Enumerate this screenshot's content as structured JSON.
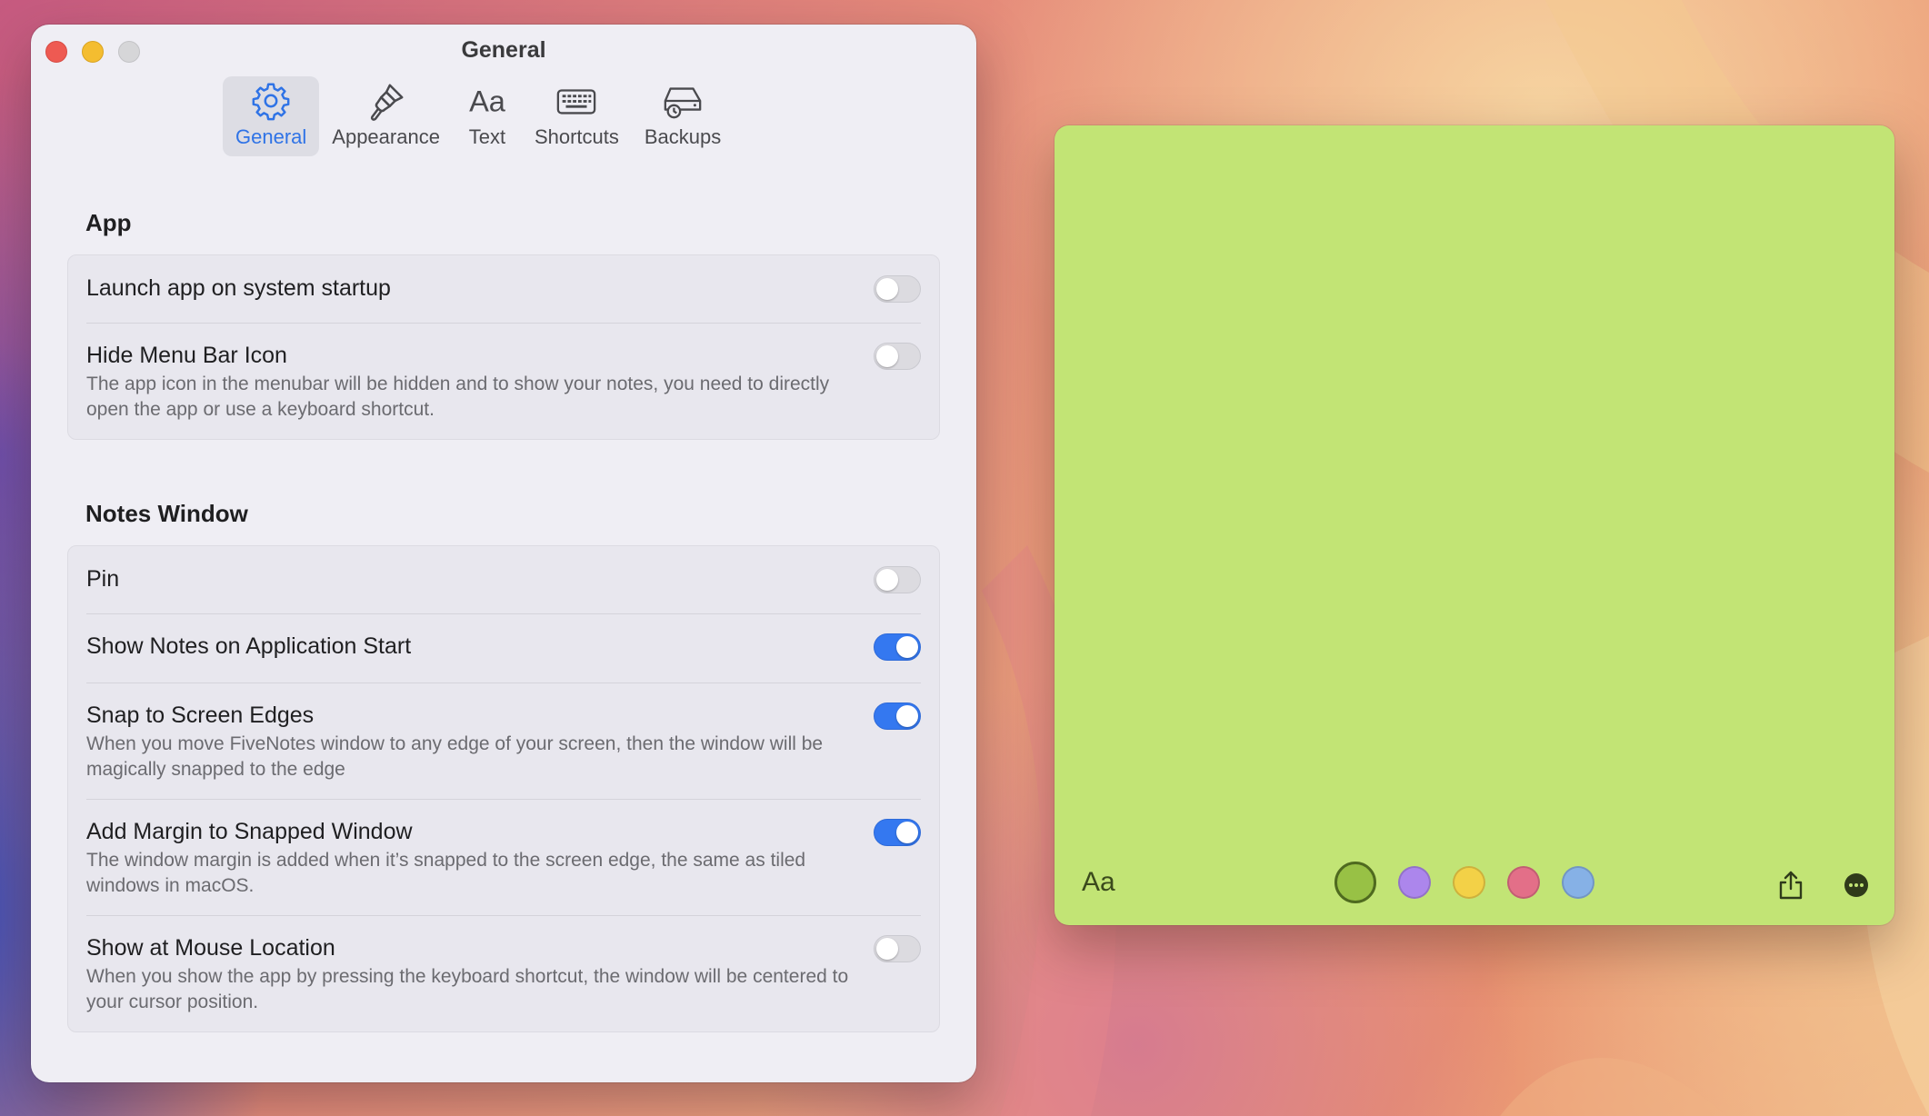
{
  "window": {
    "title": "General"
  },
  "tabs": [
    {
      "label": "General",
      "icon": "gear-icon",
      "active": true
    },
    {
      "label": "Appearance",
      "icon": "paintbrush-icon",
      "active": false
    },
    {
      "label": "Text",
      "icon": "text-format-icon",
      "active": false
    },
    {
      "label": "Shortcuts",
      "icon": "keyboard-icon",
      "active": false
    },
    {
      "label": "Backups",
      "icon": "backup-drive-icon",
      "active": false
    }
  ],
  "sections": {
    "app": {
      "title": "App",
      "rows": [
        {
          "label": "Launch app on system startup",
          "description": "",
          "enabled": false
        },
        {
          "label": "Hide Menu Bar Icon",
          "description": "The app icon in the menubar will be hidden and to show your notes, you need to directly open the app or use a keyboard shortcut.",
          "enabled": false
        }
      ]
    },
    "notes_window": {
      "title": "Notes Window",
      "rows": [
        {
          "label": "Pin",
          "description": "",
          "enabled": false
        },
        {
          "label": "Show Notes on Application Start",
          "description": "",
          "enabled": true
        },
        {
          "label": "Snap to Screen Edges",
          "description": "When you move FiveNotes window to any edge of your screen, then the window will be magically snapped to the edge",
          "enabled": true
        },
        {
          "label": "Add Margin to Snapped Window",
          "description": "The window margin is added when it’s snapped to the screen edge, the same as tiled windows in macOS.",
          "enabled": true
        },
        {
          "label": "Show at Mouse Location",
          "description": "When you show the app by pressing the keyboard shortcut, the window will be centered to your cursor position.",
          "enabled": false
        }
      ]
    }
  },
  "note": {
    "font_button": "Aa",
    "background": "#c2e475",
    "colors": [
      {
        "name": "green",
        "hex": "#98c145",
        "selected": true
      },
      {
        "name": "purple",
        "hex": "#ac86ec",
        "selected": false
      },
      {
        "name": "yellow",
        "hex": "#f3d147",
        "selected": false
      },
      {
        "name": "pink",
        "hex": "#e36f88",
        "selected": false
      },
      {
        "name": "blue",
        "hex": "#86b1e6",
        "selected": false
      }
    ],
    "actions": [
      "share-icon",
      "more-icon"
    ]
  },
  "accent_color": "#3478f0"
}
